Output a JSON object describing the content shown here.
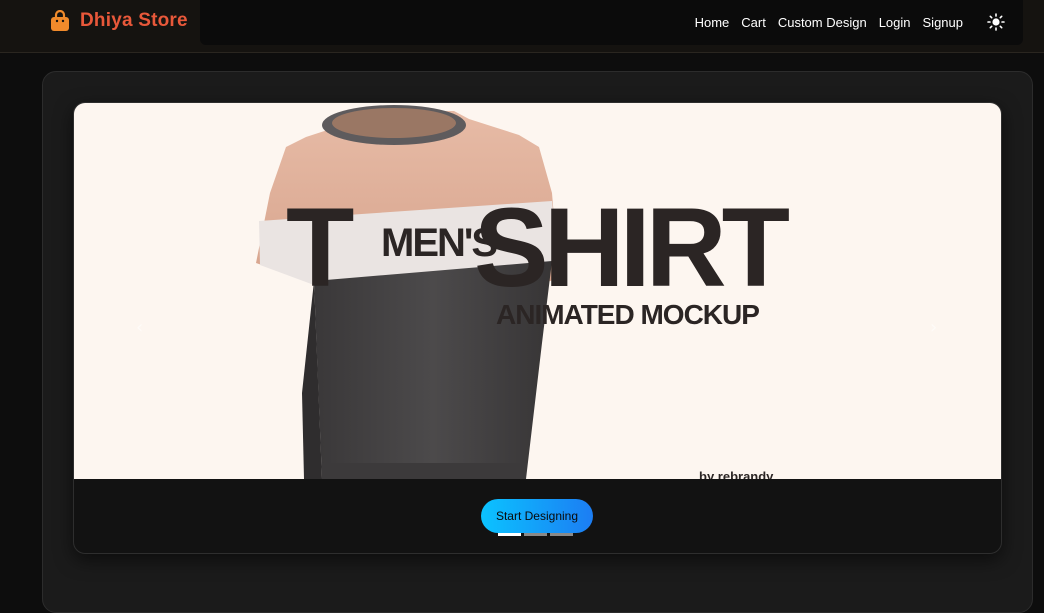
{
  "brand": {
    "name": "Dhiya Store",
    "icon": "shopping-bag-icon",
    "color": "#e8583a",
    "icon_color": "#f08a2b"
  },
  "nav": {
    "items": [
      "Home",
      "Cart",
      "Custom Design",
      "Login",
      "Signup"
    ],
    "theme_icon": "sun-icon"
  },
  "hero": {
    "slide": {
      "big_t": "T",
      "mens": "MEN'S",
      "shirt": "SHIRT",
      "subtitle": "ANIMATED MOCKUP",
      "credit": "by rebrandy"
    },
    "cta_label": "Start Designing",
    "cta_gradient": [
      "#0bc3ff",
      "#1c7df3"
    ],
    "indicator_count": 3,
    "active_indicator": 1,
    "prev_icon": "chevron-left-icon",
    "next_icon": "chevron-right-icon"
  }
}
